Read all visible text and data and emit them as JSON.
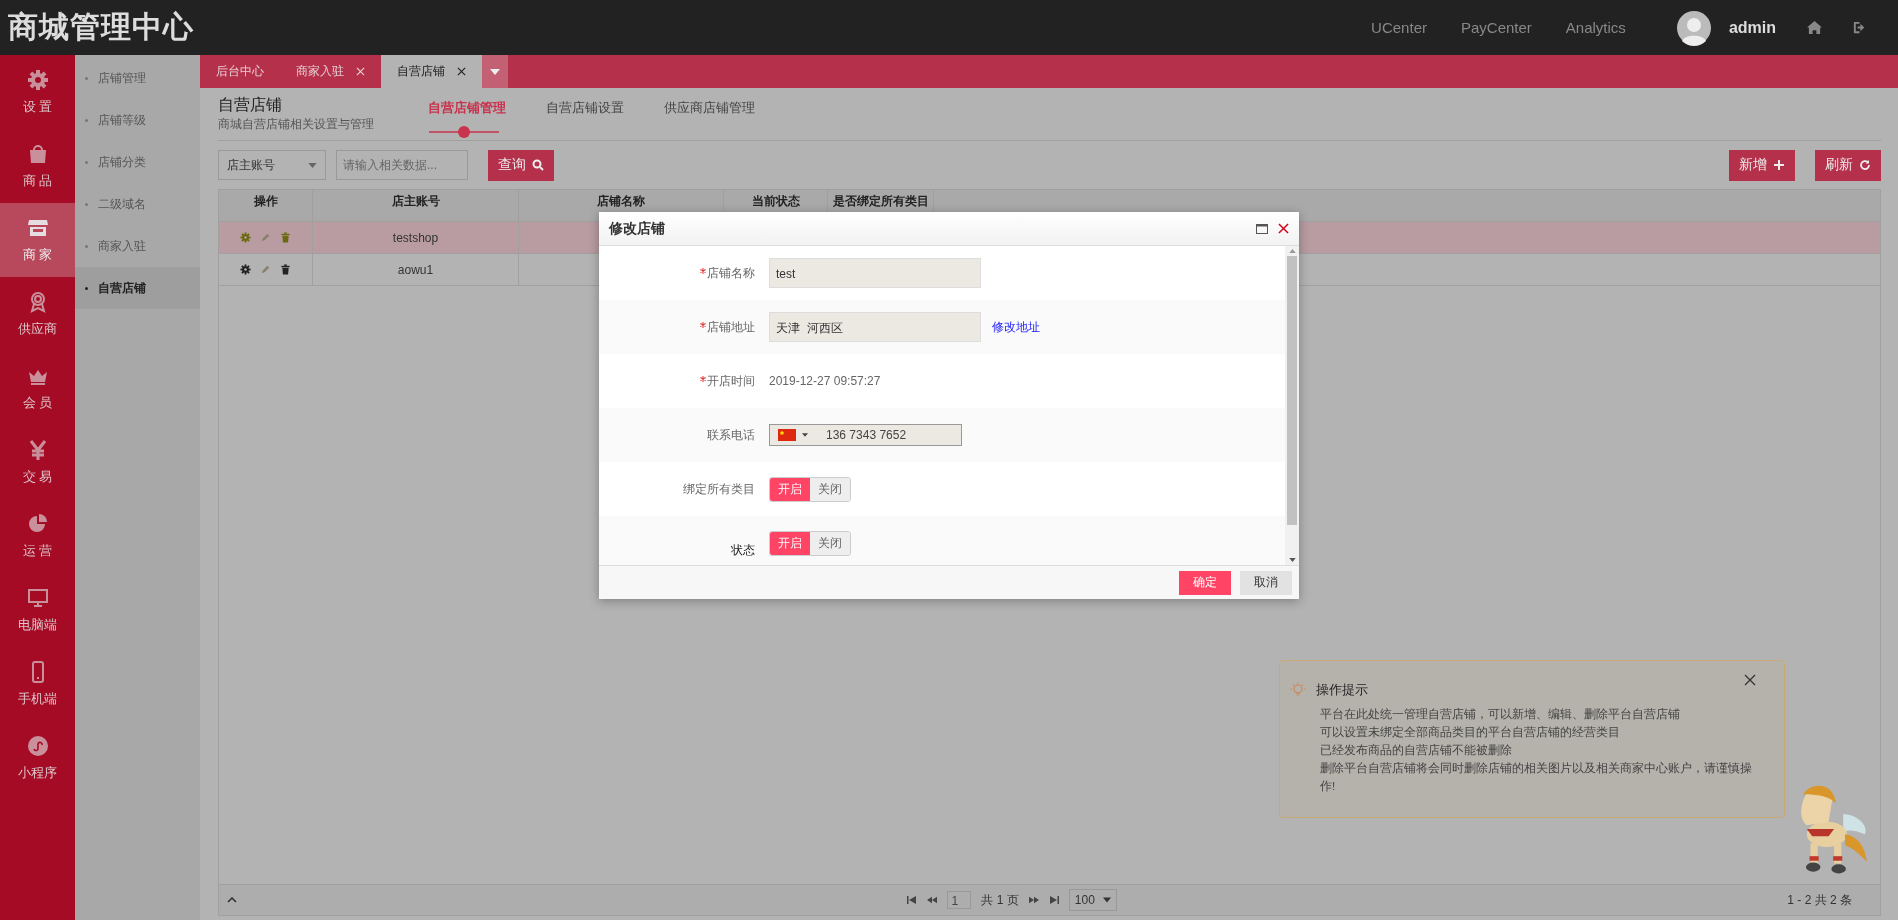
{
  "app_title": "商城管理中心",
  "top_links": [
    "UCenter",
    "PayCenter",
    "Analytics"
  ],
  "user": {
    "name": "admin"
  },
  "nav": [
    {
      "label": "设 置",
      "selected": false
    },
    {
      "label": "商 品",
      "selected": false
    },
    {
      "label": "商 家",
      "selected": true
    },
    {
      "label": "供应商",
      "selected": false
    },
    {
      "label": "会 员",
      "selected": false
    },
    {
      "label": "交 易",
      "selected": false
    },
    {
      "label": "运 营",
      "selected": false
    },
    {
      "label": "电脑端",
      "selected": false
    },
    {
      "label": "手机端",
      "selected": false
    },
    {
      "label": "小程序",
      "selected": false
    }
  ],
  "subnav": [
    {
      "label": "店铺管理",
      "selected": false
    },
    {
      "label": "店铺等级",
      "selected": false
    },
    {
      "label": "店铺分类",
      "selected": false
    },
    {
      "label": "二级域名",
      "selected": false
    },
    {
      "label": "商家入驻",
      "selected": false
    },
    {
      "label": "自营店铺",
      "selected": true
    }
  ],
  "page_tabs": [
    {
      "label": "后台中心",
      "closable": false,
      "selected": false
    },
    {
      "label": "商家入驻",
      "closable": true,
      "selected": false
    },
    {
      "label": "自营店铺",
      "closable": true,
      "selected": true
    }
  ],
  "page": {
    "title": "自营店铺",
    "subtitle": "商城自营店铺相关设置与管理",
    "tabs": [
      {
        "label": "自营店铺管理",
        "selected": true
      },
      {
        "label": "自营店铺设置",
        "selected": false
      },
      {
        "label": "供应商店铺管理",
        "selected": false
      }
    ]
  },
  "search": {
    "field": "店主账号",
    "placeholder": "请输入相关数据...",
    "button": "查询"
  },
  "actions": [
    {
      "label": "新增",
      "kind": "add"
    },
    {
      "label": "刷新",
      "kind": "refresh"
    }
  ],
  "table": {
    "columns": [
      "操作",
      "店主账号",
      "店铺名称",
      "当前状态",
      "是否绑定所有类目"
    ],
    "rows": [
      {
        "account": "testshop",
        "selected": true
      },
      {
        "account": "aowu1",
        "selected": false
      }
    ]
  },
  "pager": {
    "page": "1",
    "total": "共 1 页",
    "page_size": "100",
    "range": "1 - 2 共 2 条"
  },
  "dialog": {
    "title": "修改店铺",
    "fields": [
      {
        "kind": "input",
        "label": "店铺名称",
        "required": true,
        "value": "test"
      },
      {
        "kind": "input",
        "label": "店铺地址",
        "required": true,
        "value": "天津  河西区",
        "link": "修改地址"
      },
      {
        "kind": "text",
        "label": "开店时间",
        "required": true,
        "value": "2019-12-27 09:57:27"
      },
      {
        "kind": "phone",
        "label": "联系电话",
        "required": false,
        "value": "136 7343 7652"
      },
      {
        "kind": "toggle",
        "label": "绑定所有类目",
        "required": false,
        "options": [
          "开启",
          "关闭"
        ],
        "on": true
      },
      {
        "kind": "toggle",
        "label": "状态",
        "required": false,
        "options": [
          "开启",
          "关闭"
        ],
        "on": true
      }
    ],
    "buttons": [
      {
        "label": "确定",
        "kind": "primary"
      },
      {
        "label": "取消",
        "kind": "default"
      }
    ]
  },
  "tips": {
    "title": "操作提示",
    "lines": [
      "平台在此处统一管理自营店铺，可以新增、编辑、删除平台自营店铺",
      "可以设置未绑定全部商品类目的平台自营店铺的经营类目",
      "已经发布商品的自营店铺不能被删除",
      "删除平台自营店铺将会同时删除店铺的相关图片以及相关商家中心账户，请谨慎操作!"
    ]
  }
}
